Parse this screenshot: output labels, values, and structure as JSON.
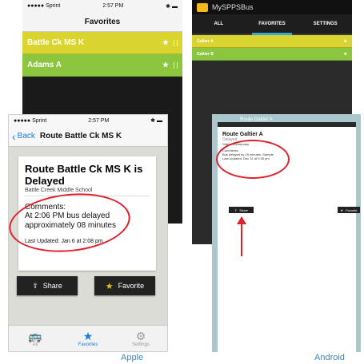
{
  "ios_favorites": {
    "status": {
      "carrier": "●●●●● Sprint",
      "time": "2:57 PM",
      "battery": "✱ ▬"
    },
    "title": "Favorites",
    "rows": [
      {
        "label": "Battle Ck MS K",
        "star": "★",
        "color": "#d9d430"
      },
      {
        "label": "Adams A",
        "star": "★",
        "color": "#8cc63f"
      }
    ]
  },
  "android_favorites": {
    "app_title": "MySPPSBus",
    "tabs": [
      "ALL",
      "FAVORITES",
      "SETTINGS"
    ],
    "active_tab": "FAVORITES",
    "rows": [
      {
        "label": "Galtier A",
        "star": "★",
        "color": "#d9d430"
      },
      {
        "label": "Galtier B",
        "star": "★",
        "color": "#8cc63f"
      }
    ]
  },
  "ios_detail": {
    "status": {
      "carrier": "●●●●● Sprint",
      "time": "2:57 PM",
      "battery": "✱ ▬"
    },
    "back_label": "Back",
    "nav_title": "Route Battle Ck MS K",
    "card": {
      "headline": "Route Battle Ck MS K is Delayed",
      "school": "Battle Creek Middle School",
      "comments_label": "Comments:",
      "comments_text": "At 2:06 PM bus delayed approximately 08 minutes",
      "last_updated": "Last Updated: Jan 6 at 2:08 pm"
    },
    "share_label": "Share",
    "favorite_label": "Favorite",
    "tabbar": [
      {
        "label": "All",
        "icon": "bus-icon",
        "glyph": "🚌"
      },
      {
        "label": "Favorites",
        "icon": "star-icon",
        "glyph": "★"
      },
      {
        "label": "Settings",
        "icon": "gear-icon",
        "glyph": "⚙"
      }
    ],
    "active_tab": "Favorites"
  },
  "android_detail": {
    "bar_title": "Route Galtier A",
    "title": "Route Galtier A",
    "status": "Delayed",
    "school": "Galtier Elementary",
    "comments_label": "Comments:",
    "comments_text": "Bus delayed by 15 minutes. Sample",
    "last_updated": "Last Updated: Dec 31 at 9:26 pm",
    "share_label": "Share",
    "favorite_label": "Favorite"
  },
  "captions": {
    "apple": "Apple",
    "android": "Android"
  },
  "colors": {
    "annotation_red": "#e0202c",
    "ios_blue": "#1a7ce0",
    "caption_blue": "#2a8fd1"
  }
}
